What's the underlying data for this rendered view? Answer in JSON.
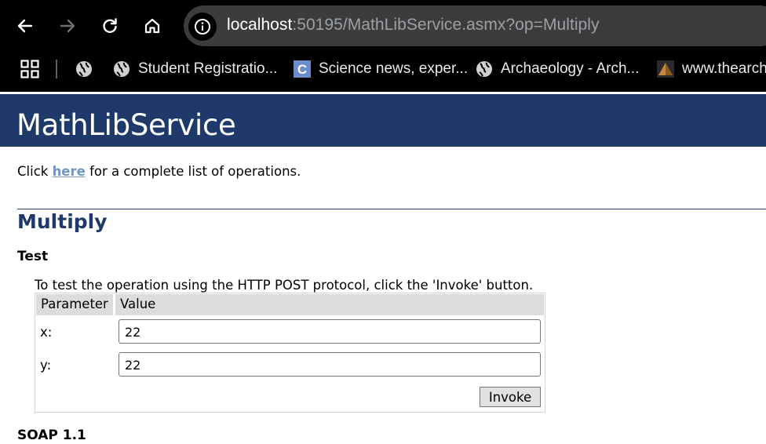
{
  "browser": {
    "url_host": "localhost",
    "url_rest": ":50195/MathLibService.asmx?op=Multiply",
    "toolbar_icons": [
      "back-arrow-icon",
      "forward-arrow-icon",
      "reload-icon",
      "home-icon",
      "site-info-icon"
    ],
    "bookmarks": [
      {
        "label": "Student Registratio...",
        "icon": "globe-icon"
      },
      {
        "label": "Science news, exper...",
        "icon": "letter-c-icon"
      },
      {
        "label": "Archaeology - Arch...",
        "icon": "globe-icon"
      },
      {
        "label": "www.thearcha",
        "icon": "pyramid-icon"
      }
    ],
    "colors": {
      "chrome_bg": "#000000",
      "address_bar_bg": "#3c3c3c",
      "url_text": "#9aa0a6",
      "url_host_text": "#ffffff"
    }
  },
  "page": {
    "service_name": "MathLibService",
    "intro_before": "Click ",
    "intro_link": "here",
    "intro_after": " for a complete list of operations.",
    "operation_name": "Multiply",
    "test_heading": "Test",
    "test_description": "To test the operation using the HTTP POST protocol, click the 'Invoke' button.",
    "table": {
      "header_parameter": "Parameter",
      "header_value": "Value",
      "params": [
        {
          "name": "x:",
          "value": "22"
        },
        {
          "name": "y:",
          "value": "22"
        }
      ]
    },
    "invoke_label": "Invoke",
    "soap_heading": "SOAP 1.1",
    "colors": {
      "heading_band": "#1f3a6a",
      "operation_title": "#1f3a6a",
      "link": "#3f73b5"
    }
  }
}
